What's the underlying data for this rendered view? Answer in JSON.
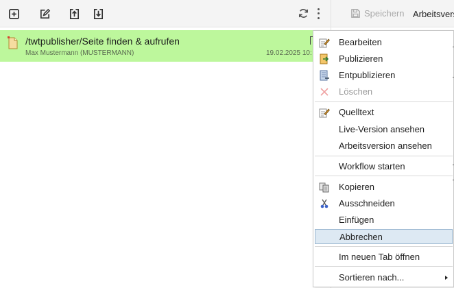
{
  "toolbar": {
    "icons": [
      "add-page-icon",
      "edit-icon",
      "upload-icon",
      "download-icon",
      "refresh-icon",
      "more-vertical-icon"
    ]
  },
  "right_toolbar": {
    "save_label": "Speichern",
    "arbeitsversion_label": "Arbeitsvers"
  },
  "row": {
    "title": "/twtpublisher/Seite finden & aufrufen",
    "author": "Max Mustermann (MUSTERMANN)",
    "date": "19.02.2025 10:"
  },
  "menu": {
    "items": [
      {
        "label": "Bearbeiten",
        "icon": "edit-pencil-icon",
        "enabled": true
      },
      {
        "label": "Publizieren",
        "icon": "publish-icon",
        "enabled": true
      },
      {
        "label": "Entpublizieren",
        "icon": "unpublish-icon",
        "enabled": true
      },
      {
        "label": "Löschen",
        "icon": "delete-x-icon",
        "enabled": false
      },
      {
        "label": "Quelltext",
        "icon": "source-icon",
        "enabled": true
      },
      {
        "label": "Live-Version ansehen",
        "icon": "",
        "enabled": true
      },
      {
        "label": "Arbeitsversion ansehen",
        "icon": "",
        "enabled": true
      },
      {
        "label": "Workflow starten",
        "icon": "",
        "enabled": true
      },
      {
        "label": "Kopieren",
        "icon": "copy-icon",
        "enabled": true
      },
      {
        "label": "Ausschneiden",
        "icon": "scissors-icon",
        "enabled": true
      },
      {
        "label": "Einfügen",
        "icon": "",
        "enabled": true
      },
      {
        "label": "Abbrechen",
        "icon": "",
        "enabled": true,
        "highlighted": true
      },
      {
        "label": "Im neuen Tab öffnen",
        "icon": "",
        "enabled": true
      },
      {
        "label": "Sortieren nach...",
        "icon": "",
        "enabled": true,
        "submenu": true
      }
    ]
  },
  "colors": {
    "row_highlight": "#bdf79c",
    "menu_hover": "#dde9f3",
    "toolbar_bg": "#f4f4f4"
  }
}
